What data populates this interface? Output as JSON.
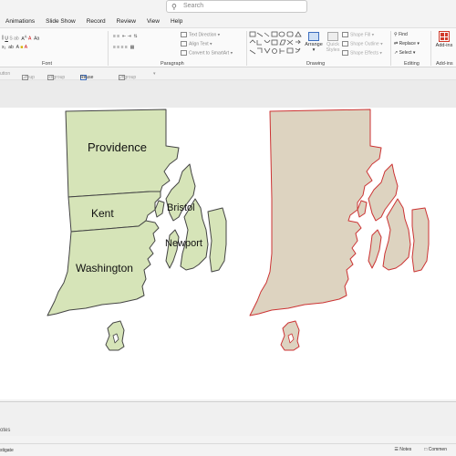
{
  "search": {
    "placeholder": "Search"
  },
  "menu": [
    "Animations",
    "Slide Show",
    "Record",
    "Review",
    "View",
    "Help"
  ],
  "ribbon": {
    "font_label": "Font",
    "paragraph_label": "Paragraph",
    "drawing_label": "Drawing",
    "editing_label": "Editing",
    "addins_label": "Add-ins",
    "text_direction": "Text Direction",
    "align_text": "Align Text",
    "convert_smartart": "Convert to SmartArt",
    "arrange": "Arrange",
    "quick_styles": "Quick Styles",
    "shape_fill": "Shape Fill",
    "shape_outline": "Shape Outline",
    "shape_effects": "Shape Effects",
    "find": "Find",
    "replace": "Replace",
    "select": "Select",
    "addins_btn": "Add-ins"
  },
  "subbar": {
    "button": "utton",
    "group": "Group",
    "regroup": "Regroup",
    "reuse_slides": "Reuse Slides",
    "ungroup": "Ungroup"
  },
  "map": {
    "counties": [
      "Providence",
      "Kent",
      "Washington",
      "Bristol",
      "Newport"
    ],
    "fill_labeled": "#d6e4b8",
    "fill_unlabeled": "#ddd3c0",
    "outline_labeled": "#444444",
    "outline_unlabeled": "#cc3333"
  },
  "notes": {
    "label": "otes"
  },
  "status": {
    "left": "stigate",
    "notes": "Notes",
    "comments": "Commen"
  }
}
